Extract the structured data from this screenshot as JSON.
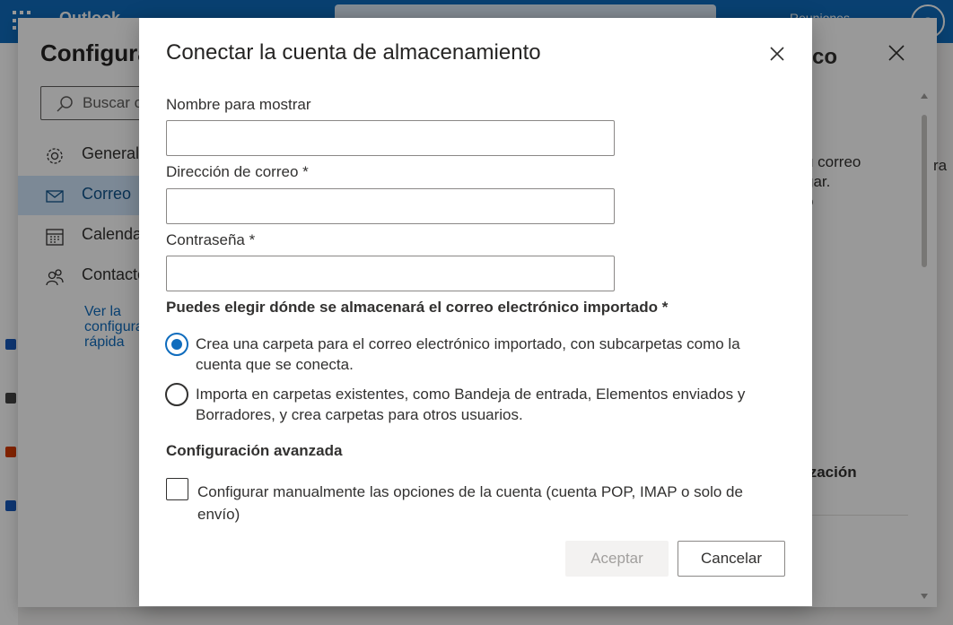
{
  "app": {
    "name": "Outlook",
    "top_right_text": "Reuniones",
    "avatar_initials": "G",
    "accent_color": "#0f6cbd"
  },
  "settings_panel": {
    "title": "Configuración",
    "search_placeholder": "Buscar configuración",
    "nav_items": [
      {
        "label": "General",
        "icon": "gear-icon"
      },
      {
        "label": "Correo",
        "icon": "mail-icon",
        "active": true
      },
      {
        "label": "Calendario",
        "icon": "calendar-icon"
      },
      {
        "label": "Contactos",
        "icon": "people-icon"
      }
    ],
    "quick_link": "Ver la configuración rápida",
    "right_partial_title": "co",
    "right_partial_lines": [
      "u correo",
      "gar.",
      "o"
    ],
    "right_partial_section": "ización",
    "far_right_fragment": "ra"
  },
  "dialog": {
    "title": "Conectar la cuenta de almacenamiento",
    "fields": {
      "display_name_label": "Nombre para mostrar",
      "display_name_value": "",
      "email_label": "Dirección de correo *",
      "email_value": "",
      "password_label": "Contraseña *",
      "password_value": ""
    },
    "storage_question": "Puedes elegir dónde se almacenará el correo electrónico importado *",
    "options": [
      {
        "text": "Crea una carpeta para el correo electrónico importado, con subcarpetas como la cuenta que se conecta.",
        "selected": true
      },
      {
        "text": "Importa en carpetas existentes, como Bandeja de entrada, Elementos enviados y Borradores, y crea carpetas para otros usuarios.",
        "selected": false
      }
    ],
    "advanced_title": "Configuración avanzada",
    "manual_config_label": "Configurar manualmente las opciones de la cuenta (cuenta POP, IMAP o solo de envío)",
    "manual_config_checked": false,
    "accept_label": "Aceptar",
    "cancel_label": "Cancelar"
  }
}
